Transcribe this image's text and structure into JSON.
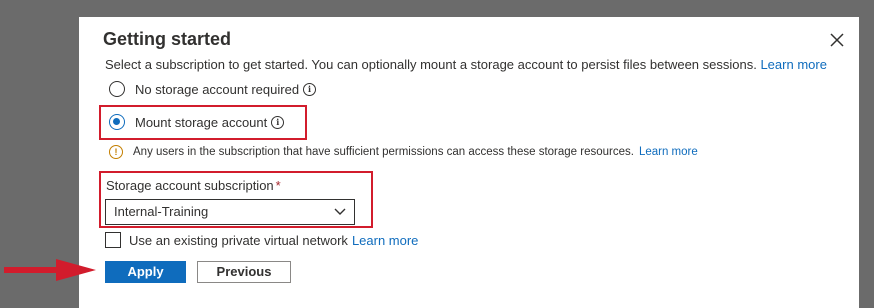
{
  "dialog": {
    "title": "Getting started",
    "description": "Select a subscription to get started. You can optionally mount a storage account to persist files between sessions.",
    "learn_more": "Learn more"
  },
  "options": [
    {
      "label": "No storage account required",
      "selected": false
    },
    {
      "label": "Mount storage account",
      "selected": true
    }
  ],
  "warning": {
    "text": "Any users in the subscription that have sufficient permissions can access these storage resources.",
    "learn_more": "Learn more"
  },
  "subscription": {
    "label": "Storage account subscription",
    "required_mark": "*",
    "value": "Internal-Training"
  },
  "vnet": {
    "label": "Use an existing private virtual network",
    "learn_more": "Learn more",
    "checked": false
  },
  "buttons": {
    "apply": "Apply",
    "previous": "Previous"
  },
  "colors": {
    "accent": "#0f6cbd",
    "highlight": "#d21c2c",
    "warning": "#c47f00"
  },
  "icons": [
    "close-icon",
    "info-icon",
    "warning-icon",
    "chevron-down-icon",
    "arrow-icon"
  ]
}
